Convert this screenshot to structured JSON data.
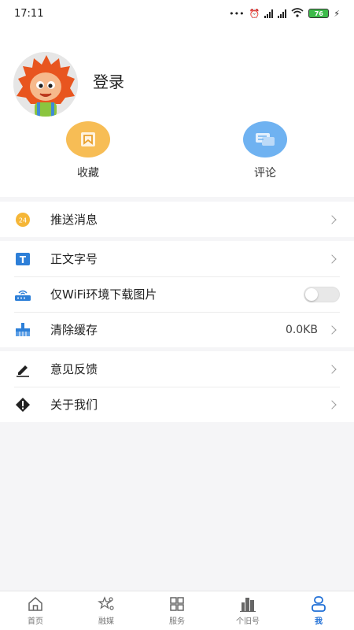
{
  "status_bar": {
    "time": "17:11",
    "battery": "76"
  },
  "profile": {
    "login_label": "登录"
  },
  "quick_actions": [
    {
      "label": "收藏",
      "icon": "bookmark-icon",
      "color": "#f7bd55"
    },
    {
      "label": "评论",
      "icon": "comment-icon",
      "color": "#6fb2f1"
    }
  ],
  "menu": {
    "push": {
      "label": "推送消息",
      "icon": "notification-icon"
    },
    "font_size": {
      "label": "正文字号",
      "icon": "text-size-icon"
    },
    "wifi_images": {
      "label": "仅WiFi环境下载图片",
      "icon": "router-icon",
      "enabled": false
    },
    "clear_cache": {
      "label": "清除缓存",
      "value": "0.0KB",
      "icon": "broom-icon"
    },
    "feedback": {
      "label": "意见反馈",
      "icon": "pen-icon"
    },
    "about": {
      "label": "关于我们",
      "icon": "info-diamond-icon"
    }
  },
  "tabs": [
    {
      "label": "首页",
      "icon": "home-icon",
      "active": false
    },
    {
      "label": "融媒",
      "icon": "media-icon",
      "active": false
    },
    {
      "label": "服务",
      "icon": "grid-icon",
      "active": false
    },
    {
      "label": "个旧号",
      "icon": "city-icon",
      "active": false
    },
    {
      "label": "我",
      "icon": "user-icon",
      "active": true
    }
  ],
  "colors": {
    "accent": "#1f6fd6",
    "background": "#f5f5f7"
  }
}
